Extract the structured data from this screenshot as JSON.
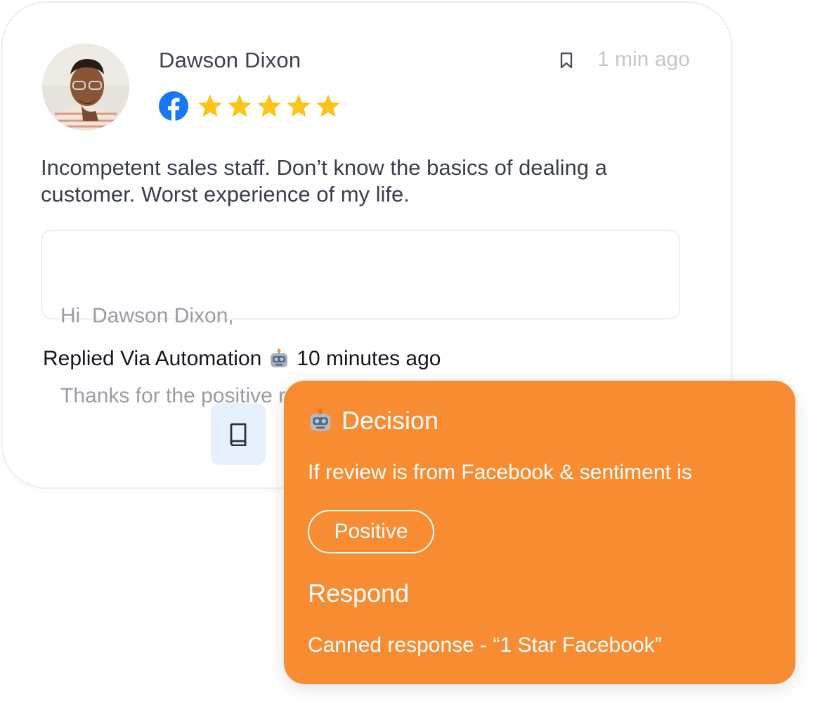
{
  "review": {
    "reviewer_name": "Dawson Dixon",
    "timestamp": "1 min ago",
    "source_icon": "facebook-icon",
    "rating": 5,
    "rating_max": 5,
    "text": "Incompetent sales staff. Don’t know the basics of dealing a customer. Worst experience of my life.",
    "reply": {
      "greeting": "Hi  Dawson Dixon,",
      "body": "Thanks for the positive rating. Your words motivates us."
    },
    "automation": {
      "prefix": "Replied Via Automation",
      "icon": "robot-icon",
      "time": "10 minutes ago"
    },
    "action_icon": "book-icon"
  },
  "decision": {
    "icon": "robot-icon",
    "title": "Decision",
    "condition": "If review is from Facebook & sentiment is",
    "sentiment": "Positive",
    "respond_heading": "Respond",
    "response": "Canned response - “1 Star Facebook”"
  },
  "colors": {
    "decision_bg": "#f78c33",
    "star": "#fcc419",
    "facebook": "#1877f2",
    "action_bg": "#e7f1fd"
  }
}
